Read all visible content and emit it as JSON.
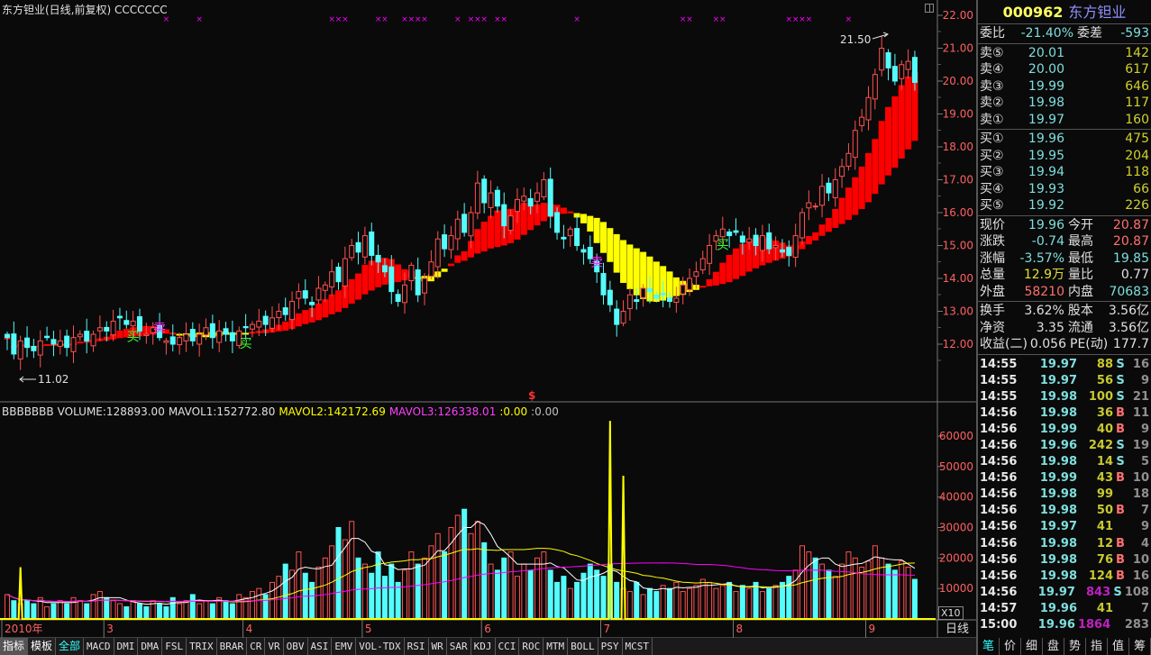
{
  "header": {
    "title": "东方钽业(日线,前复权) CCCCCCC"
  },
  "volume_header": {
    "name": "BBBBBBB",
    "volume": "VOLUME:128893.00",
    "mavol1": "MAVOL1:152772.80",
    "mavol2": "MAVOL2:142172.69",
    "mavol3": "MAVOL3:126338.01",
    "x1": ":0.00",
    "x2": ":0.00"
  },
  "colors": {
    "up": "#ff5050",
    "down": "#54fcfc",
    "ma_up": "#ff0000",
    "ma_down": "#ffff00",
    "mavol1": "#ffffff",
    "mavol2": "#ffff00",
    "mavol3": "#ff00ff",
    "signal": "#ff00ff"
  },
  "chart_data": {
    "type": "candlestick",
    "price_axis": {
      "ticks": [
        "22.00",
        "21.00",
        "20.00",
        "19.00",
        "18.00",
        "17.00",
        "16.00",
        "15.00",
        "14.00",
        "13.00",
        "12.00"
      ],
      "range": [
        12,
        22
      ]
    },
    "volume_axis": {
      "ticks": [
        "60000",
        "50000",
        "40000",
        "30000",
        "20000",
        "10000"
      ],
      "range": [
        0,
        60000
      ]
    },
    "date_labels": [
      {
        "label": "2010年",
        "index": 0
      },
      {
        "label": "3",
        "index": 15
      },
      {
        "label": "4",
        "index": 36
      },
      {
        "label": "5",
        "index": 54
      },
      {
        "label": "6",
        "index": 72
      },
      {
        "label": "7",
        "index": 90
      },
      {
        "label": "8",
        "index": 110
      },
      {
        "label": "9",
        "index": 130
      }
    ],
    "close": [
      12.2,
      11.7,
      12.1,
      11.9,
      11.8,
      12.1,
      12.2,
      12.0,
      12.1,
      11.9,
      12.2,
      12.3,
      12.1,
      12.3,
      12.5,
      12.4,
      12.7,
      12.8,
      12.6,
      12.7,
      12.4,
      12.3,
      12.5,
      12.2,
      12.1,
      12.0,
      12.2,
      12.3,
      12.1,
      12.3,
      12.5,
      12.2,
      12.4,
      12.3,
      12.1,
      12.4,
      12.5,
      12.6,
      12.7,
      12.6,
      12.8,
      13.0,
      12.9,
      13.3,
      13.6,
      13.4,
      13.2,
      13.7,
      13.8,
      14.2,
      13.9,
      14.6,
      15.0,
      14.8,
      15.3,
      14.7,
      14.5,
      14.2,
      13.6,
      13.3,
      13.8,
      14.4,
      13.5,
      14.0,
      14.5,
      15.2,
      14.9,
      15.3,
      15.8,
      15.4,
      16.0,
      16.9,
      16.3,
      16.6,
      16.2,
      15.6,
      15.9,
      16.4,
      16.5,
      16.2,
      16.6,
      17.0,
      15.9,
      15.4,
      15.2,
      15.5,
      15.0,
      14.8,
      14.6,
      14.2,
      13.5,
      13.2,
      12.6,
      13.0,
      13.5,
      13.3,
      13.7,
      13.6,
      13.4,
      13.5,
      13.3,
      13.4,
      13.8,
      14.0,
      14.2,
      14.6,
      15.0,
      15.3,
      15.5,
      15.3,
      15.4,
      15.1,
      15.2,
      15.0,
      15.3,
      14.9,
      15.0,
      14.8,
      14.7,
      15.3,
      16.0,
      16.3,
      16.2,
      16.8,
      16.6,
      17.0,
      17.4,
      17.8,
      18.5,
      18.9,
      19.5,
      20.2,
      21.0,
      20.4,
      20.0,
      20.5,
      20.6,
      19.96
    ],
    "volume_thousands": [
      8,
      6,
      5,
      6,
      5,
      7,
      4,
      5,
      6,
      5,
      7,
      6,
      5,
      8,
      9,
      7,
      6,
      5,
      4,
      6,
      5,
      4,
      6,
      5,
      4,
      7,
      5,
      6,
      8,
      5,
      6,
      5,
      7,
      6,
      5,
      8,
      7,
      9,
      10,
      8,
      12,
      14,
      18,
      16,
      22,
      15,
      12,
      17,
      20,
      24,
      30,
      26,
      32,
      20,
      18,
      15,
      22,
      14,
      18,
      12,
      16,
      22,
      18,
      20,
      24,
      28,
      22,
      30,
      34,
      36,
      28,
      32,
      25,
      18,
      16,
      20,
      22,
      14,
      18,
      16,
      20,
      22,
      16,
      12,
      14,
      10,
      12,
      15,
      18,
      16,
      14,
      18,
      12,
      10,
      9,
      12,
      8,
      10,
      9,
      11,
      10,
      12,
      9,
      10,
      11,
      13,
      12,
      10,
      11,
      12,
      9,
      11,
      10,
      12,
      9,
      10,
      11,
      12,
      14,
      16,
      24,
      22,
      20,
      18,
      16,
      14,
      18,
      22,
      20,
      17,
      19,
      24,
      20,
      18,
      16,
      19,
      17,
      13
    ],
    "signal_spikes": [
      {
        "index": 2,
        "value": 17000
      },
      {
        "index": 91,
        "value": 65000
      },
      {
        "index": 93,
        "value": 47000
      }
    ],
    "top_markers": [
      24,
      29,
      49,
      50,
      51,
      56,
      57,
      60,
      61,
      62,
      63,
      68,
      70,
      71,
      72,
      74,
      75,
      86,
      102,
      103,
      107,
      108,
      118,
      119,
      120,
      121,
      127
    ],
    "trade_signals": [
      {
        "index": 19,
        "text": "买",
        "type": "buy"
      },
      {
        "index": 23,
        "text": "卖",
        "type": "sell"
      },
      {
        "index": 36,
        "text": "买",
        "type": "buy"
      },
      {
        "index": 89,
        "text": "卖",
        "type": "sell"
      },
      {
        "index": 108,
        "text": "买",
        "type": "buy"
      }
    ],
    "annotations": {
      "high": "21.50",
      "low": "11.02",
      "dollar": "$"
    }
  },
  "quote": {
    "code": "000962",
    "name": "东方钽业",
    "weibi_label": "委比",
    "weibi": "-21.40%",
    "weicha_label": "委差",
    "weicha": "-593",
    "asks": [
      {
        "label": "卖⑤",
        "price": "20.01",
        "vol": "142"
      },
      {
        "label": "卖④",
        "price": "20.00",
        "vol": "617"
      },
      {
        "label": "卖③",
        "price": "19.99",
        "vol": "646"
      },
      {
        "label": "卖②",
        "price": "19.98",
        "vol": "117"
      },
      {
        "label": "卖①",
        "price": "19.97",
        "vol": "160"
      }
    ],
    "bids": [
      {
        "label": "买①",
        "price": "19.96",
        "vol": "475"
      },
      {
        "label": "买②",
        "price": "19.95",
        "vol": "204"
      },
      {
        "label": "买③",
        "price": "19.94",
        "vol": "118"
      },
      {
        "label": "买④",
        "price": "19.93",
        "vol": "66"
      },
      {
        "label": "买⑤",
        "price": "19.92",
        "vol": "226"
      }
    ],
    "stats": [
      {
        "l1": "现价",
        "v1": "19.96",
        "c1": "#7fdede",
        "l2": "今开",
        "v2": "20.87",
        "c2": "#ff7070"
      },
      {
        "l1": "涨跌",
        "v1": "-0.74",
        "c1": "#7fdede",
        "l2": "最高",
        "v2": "20.87",
        "c2": "#ff7070"
      },
      {
        "l1": "涨幅",
        "v1": "-3.57%",
        "c1": "#7fdede",
        "l2": "最低",
        "v2": "19.85",
        "c2": "#7fdede"
      },
      {
        "l1": "总量",
        "v1": "12.9万",
        "c1": "#e0e030",
        "l2": "量比",
        "v2": "0.77",
        "c2": "#e0e0e0"
      },
      {
        "l1": "外盘",
        "v1": "58210",
        "c1": "#ff7070",
        "l2": "内盘",
        "v2": "70683",
        "c2": "#7fdede"
      }
    ],
    "finance": [
      {
        "l1": "换手",
        "v1": "3.62%",
        "l2": "股本",
        "v2": "3.56亿"
      },
      {
        "l1": "净资",
        "v1": "3.35",
        "l2": "流通",
        "v2": "3.56亿"
      },
      {
        "l1": "收益(二)",
        "v1": "0.056",
        "l2": "PE(动)",
        "v2": "177.7"
      }
    ]
  },
  "ticks": [
    {
      "t": "14:55",
      "p": "19.97",
      "v": "88",
      "s": "S",
      "n": "16"
    },
    {
      "t": "14:55",
      "p": "19.97",
      "v": "56",
      "s": "S",
      "n": "9"
    },
    {
      "t": "14:55",
      "p": "19.98",
      "v": "100",
      "s": "S",
      "n": "21"
    },
    {
      "t": "14:56",
      "p": "19.98",
      "v": "36",
      "s": "B",
      "n": "11"
    },
    {
      "t": "14:56",
      "p": "19.99",
      "v": "40",
      "s": "B",
      "n": "9"
    },
    {
      "t": "14:56",
      "p": "19.96",
      "v": "242",
      "s": "S",
      "n": "19"
    },
    {
      "t": "14:56",
      "p": "19.98",
      "v": "14",
      "s": "S",
      "n": "5"
    },
    {
      "t": "14:56",
      "p": "19.99",
      "v": "43",
      "s": "B",
      "n": "10"
    },
    {
      "t": "14:56",
      "p": "19.98",
      "v": "99",
      "s": "",
      "n": "18"
    },
    {
      "t": "14:56",
      "p": "19.98",
      "v": "50",
      "s": "B",
      "n": "7"
    },
    {
      "t": "14:56",
      "p": "19.97",
      "v": "41",
      "s": "",
      "n": "9"
    },
    {
      "t": "14:56",
      "p": "19.98",
      "v": "12",
      "s": "B",
      "n": "4"
    },
    {
      "t": "14:56",
      "p": "19.98",
      "v": "76",
      "s": "B",
      "n": "10"
    },
    {
      "t": "14:56",
      "p": "19.98",
      "v": "124",
      "s": "B",
      "n": "16"
    },
    {
      "t": "14:56",
      "p": "19.97",
      "v": "843",
      "s": "S",
      "n": "108",
      "big": true
    },
    {
      "t": "14:57",
      "p": "19.96",
      "v": "41",
      "s": "",
      "n": "7"
    },
    {
      "t": "15:00",
      "p": "19.96",
      "v": "1864",
      "s": "",
      "n": "283",
      "big": true
    }
  ],
  "bottom_tabs": {
    "indicator": "指标",
    "template": "模板",
    "all": "全部",
    "items": [
      "MACD",
      "DMI",
      "DMA",
      "FSL",
      "TRIX",
      "BRAR",
      "CR",
      "VR",
      "OBV",
      "ASI",
      "EMV",
      "VOL-TDX",
      "RSI",
      "WR",
      "SAR",
      "KDJ",
      "CCI",
      "ROC",
      "MTM",
      "BOLL",
      "PSY",
      "MCST"
    ]
  },
  "period_label": "日线",
  "zoom_label": "X10",
  "right_tabs": [
    "笔",
    "价",
    "细",
    "盘",
    "势",
    "指",
    "值",
    "筹"
  ]
}
